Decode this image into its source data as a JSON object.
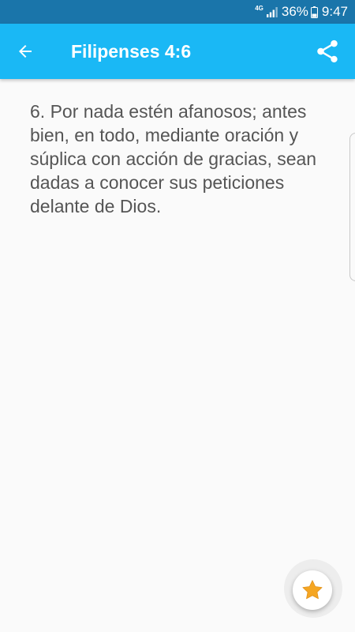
{
  "status_bar": {
    "network": "4G",
    "battery_percent": "36%",
    "time": "9:47",
    "icons": [
      "signal-icon",
      "battery-icon"
    ]
  },
  "app_bar": {
    "title": "Filipenses 4:6",
    "back_icon": "arrow-left-icon",
    "share_icon": "share-icon",
    "background_color": "#1ab8f5"
  },
  "content": {
    "verse_text": "6. Por nada estén afanosos; antes bien, en todo, mediante oración y súplica con acción de gracias, sean dadas a conocer sus peticiones delante de Dios."
  },
  "fab": {
    "icon": "star-icon",
    "star_color": "#f5a623"
  }
}
